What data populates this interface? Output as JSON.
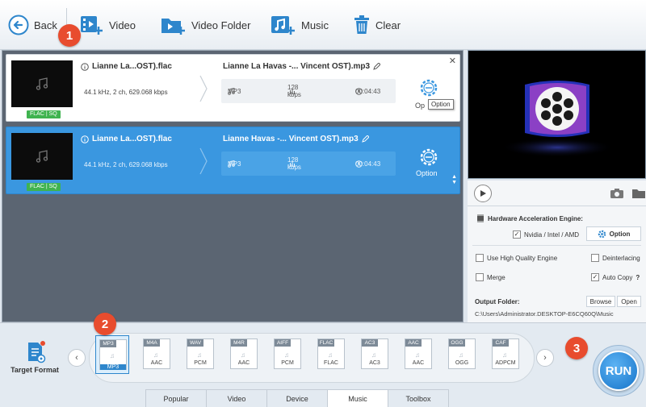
{
  "toolbar": {
    "back": "Back",
    "video": "Video",
    "video_folder": "Video Folder",
    "music": "Music",
    "clear": "Clear"
  },
  "markers": [
    "1",
    "2",
    "3"
  ],
  "tasks": [
    {
      "source_name": "Lianne La...OST).flac",
      "source_info": "44.1 kHz, 2 ch, 629.068 kbps",
      "badge": "FLAC | SQ",
      "output_name": "Lianne La Havas -... Vincent OST).mp3",
      "format": "MP3",
      "bitrate": "128 kbps",
      "duration": "00:04:43",
      "option_label": "Op",
      "tooltip": "Option"
    },
    {
      "source_name": "Lianne La...OST).flac",
      "source_info": "44.1 kHz, 2 ch, 629.068 kbps",
      "badge": "FLAC | SQ",
      "output_name": "Lianne Havas -... Vincent OST).mp3",
      "format": "MP3",
      "bitrate": "128 kbps",
      "duration": "00:04:43",
      "option_label": "Option"
    }
  ],
  "settings": {
    "hw_title": "Hardware Acceleration Engine:",
    "nvidia": "Nvidia / Intel / AMD",
    "option_btn": "Option",
    "high_quality": "Use High Quality Engine",
    "deinterlacing": "Deinterlacing",
    "merge": "Merge",
    "auto_copy": "Auto Copy",
    "help": "?",
    "output_folder": "Output Folder:",
    "browse": "Browse",
    "open": "Open",
    "output_path": "C:\\Users\\Administrator.DESKTOP-E6CQ60Q\\Music"
  },
  "bottom": {
    "target_format": "Target Format",
    "formats": [
      {
        "top": "MP3",
        "bottom": "MP3"
      },
      {
        "top": "M4A",
        "bottom": "AAC"
      },
      {
        "top": "WAV",
        "bottom": "PCM"
      },
      {
        "top": "M4R",
        "bottom": "AAC"
      },
      {
        "top": "AIFF",
        "bottom": "PCM"
      },
      {
        "top": "FLAC",
        "bottom": "FLAC"
      },
      {
        "top": "AC3",
        "bottom": "AC3"
      },
      {
        "top": "AAC",
        "bottom": "AAC"
      },
      {
        "top": "OGG",
        "bottom": "OGG"
      },
      {
        "top": "CAF",
        "bottom": "ADPCM"
      }
    ],
    "run": "RUN",
    "tabs": [
      "Popular",
      "Video",
      "Device",
      "Music",
      "Toolbox"
    ],
    "active_tab": "Music"
  },
  "colors": {
    "accent": "#3a97e0",
    "marker": "#e84c2e",
    "badge": "#3fb34f"
  }
}
